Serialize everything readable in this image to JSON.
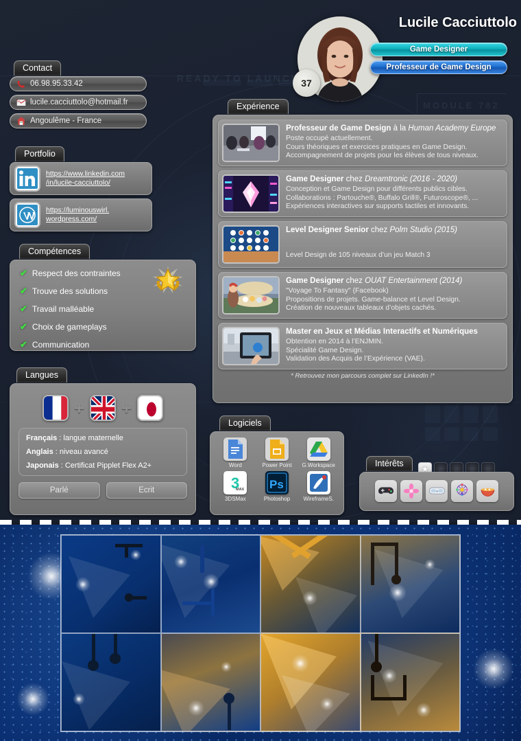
{
  "header": {
    "name": "Lucile Cacciuttolo",
    "age": "37",
    "title_badges": [
      {
        "label": "Game Designer",
        "color": "#14b8c4"
      },
      {
        "label": "Professeur de Game Design",
        "color": "#1f6fd0"
      }
    ],
    "avatar_alt": "portrait-photo"
  },
  "background": {
    "hud_text_left": "READY TO LAUNCH",
    "hud_text_right": "MODULE  782"
  },
  "contact": {
    "tab": "Contact",
    "items": [
      {
        "icon": "phone-icon",
        "glyph": "☎",
        "value": "06.98.95.33.42"
      },
      {
        "icon": "mail-icon",
        "glyph": "✉",
        "value": "lucile.cacciuttolo@hotmail.fr"
      },
      {
        "icon": "home-icon",
        "glyph": "⌂",
        "value": "Angoulême - France"
      }
    ]
  },
  "portfolio": {
    "tab": "Portfolio",
    "items": [
      {
        "icon": "linkedin-icon",
        "line1": "https://www.linkedin.com",
        "line2": "/in/lucile-cacciuttolo/"
      },
      {
        "icon": "wordpress-icon",
        "line1": "https://luminouswirl.",
        "line2": "wordpress.com/"
      }
    ]
  },
  "competences": {
    "tab": "Compétences",
    "badge": "gold-star-badge",
    "items": [
      "Respect des contraintes",
      "Trouve des solutions",
      "Travail malléable",
      "Choix de gameplays",
      "Communication"
    ]
  },
  "langues": {
    "tab": "Langues",
    "flags": [
      "flag-france",
      "flag-uk",
      "flag-japan"
    ],
    "separator": "+",
    "lines": [
      {
        "lang": "Français",
        "level": " : langue maternelle"
      },
      {
        "lang": "Anglais",
        "level": " : niveau avancé"
      },
      {
        "lang": "Japonais",
        "level": " : Certificat Pipplet Flex A2+"
      }
    ],
    "buttons": [
      "Parlé",
      "Ecrit"
    ]
  },
  "experience": {
    "tab": "Expérience",
    "note": "* Retrouvez mon parcours complet sur LinkedIn !*",
    "items": [
      {
        "thumb": "classroom-photo",
        "role": "Professeur de Game Design",
        "connector": " à la ",
        "company": "Human Academy Europe",
        "desc": [
          "Poste occupé actuellement.",
          "Cours théoriques et exercices pratiques en Game Design.",
          "Accompagnement de projets pour les élèves de tous niveaux."
        ]
      },
      {
        "thumb": "crystal-game-photo",
        "role": "Game Designer",
        "connector": " chez ",
        "company": "Dreamtronic (2016 - 2020)",
        "desc": [
          "Conception et Game Design pour différents publics cibles.",
          "Collaborations : Partouche®, Buffalo Grill®, Futuroscope®, ...",
          "Expériences interactives sur supports tactiles et innovants."
        ]
      },
      {
        "thumb": "match3-game-photo",
        "role": "Level Designer Senior",
        "connector": " chez ",
        "company": "Polm Studio (2015)",
        "desc": [
          "",
          "Level Design de 105 niveaux d’un jeu Match 3"
        ]
      },
      {
        "thumb": "fantasy-game-photo",
        "role": "Game Designer",
        "connector": " chez ",
        "company": "OUAT Entertainment (2014)",
        "desc": [
          "\"Voyage To Fantasy\" (Facebook)",
          "Propositions de projets. Game-balance et Level Design.",
          "Création de nouveaux tableaux d’objets cachés."
        ]
      },
      {
        "thumb": "tablet-ar-photo",
        "role": "Master en Jeux et Médias Interactifs et Numériques",
        "connector": "",
        "company": "",
        "desc": [
          "Obtention en 2014 à l’ENJMIN.",
          "Spécialité Game Design.",
          "Validation des Acquis de l’Expérience (VAE)."
        ]
      }
    ]
  },
  "logiciels": {
    "tab": "Logiciels",
    "items": [
      {
        "icon": "word-icon",
        "label": "Word"
      },
      {
        "icon": "powerpoint-icon",
        "label": "Power Point"
      },
      {
        "icon": "google-drive-icon",
        "label": "G.Workspace"
      },
      {
        "icon": "3dsmax-icon",
        "label": "3DSMax"
      },
      {
        "icon": "photoshop-icon",
        "label": "Photoshop"
      },
      {
        "icon": "wireframesketcher-icon",
        "label": "WireframeS."
      }
    ]
  },
  "interets": {
    "tab": "Intérêts",
    "stars_total": 5,
    "stars_filled": 1,
    "items": [
      {
        "icon": "gamepad-icon",
        "glyph": "🎮"
      },
      {
        "icon": "sakura-flower-icon",
        "glyph": "🌸"
      },
      {
        "icon": "vr-headset-icon",
        "glyph": "🥽"
      },
      {
        "icon": "ferris-wheel-icon",
        "glyph": "🎡"
      },
      {
        "icon": "ramen-bowl-icon",
        "glyph": "🍜"
      }
    ]
  },
  "bottom_band": {
    "name": "decorative-image-grid",
    "tiles": 8
  }
}
